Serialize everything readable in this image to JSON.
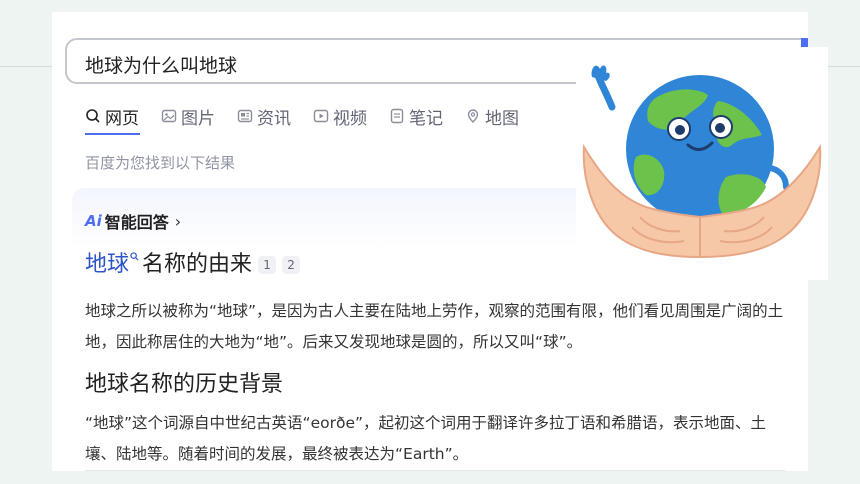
{
  "search": {
    "query": "地球为什么叫地球"
  },
  "tabs": [
    {
      "label": "网页",
      "icon": "search-icon",
      "active": true
    },
    {
      "label": "图片",
      "icon": "image-icon"
    },
    {
      "label": "资讯",
      "icon": "news-icon"
    },
    {
      "label": "视频",
      "icon": "video-icon"
    },
    {
      "label": "笔记",
      "icon": "notes-icon"
    },
    {
      "label": "地图",
      "icon": "map-icon"
    }
  ],
  "result_hint": "百度为您找到以下结果",
  "ai_answer": {
    "logo": "Ai",
    "label": "智能回答",
    "arrow": "›",
    "heading_link": "地球",
    "heading_rest": "名称的由来",
    "refs": [
      "1",
      "2"
    ],
    "para1": "地球之所以被称为“地球”，是因为古人主要在陆地上劳作，观察的范围有限，他们看见周围是广阔的土地，因此称居住的大地为“地”。后来又发现地球是圆的，所以又叫“球”。",
    "heading2": "地球名称的历史背景",
    "para2": "“地球”这个词源自中世纪古英语“eorðe”，起初这个词用于翻译许多拉丁语和希腊语，表示地面、土壤、陆地等。随着时间的发展，最终被表达为“Earth”。"
  },
  "colors": {
    "accent": "#4e6ef2",
    "link": "#2e54c8",
    "ocean": "#2f86d6",
    "land": "#6cc24a",
    "hands": "#f7c8a8"
  }
}
